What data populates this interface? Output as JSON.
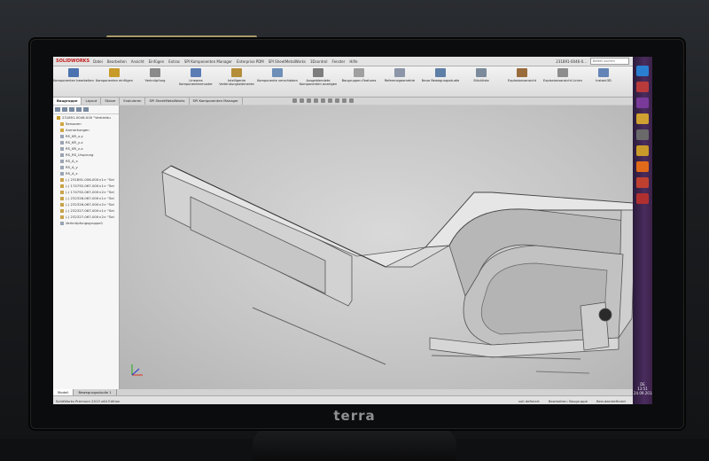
{
  "monitor": {
    "brand": "terra"
  },
  "app": {
    "logo": "SOLIDWORKS",
    "menu": [
      "Datei",
      "Bearbeiten",
      "Ansicht",
      "Einfügen",
      "Extras",
      "SPI Komponenten Manager",
      "Enterprise PDM",
      "SPI SheetMetalWorks",
      "3Dcontrol",
      "Fenster",
      "Hilfe"
    ],
    "document_title": "231891-0046-0...",
    "search_placeholder": "Befehl suchen"
  },
  "ribbon": [
    {
      "label": "Komponenten bearbeiten",
      "color": "#4b73b0"
    },
    {
      "label": "Komponenten einfügen",
      "color": "#c89a2a"
    },
    {
      "label": "Verknüpfung",
      "color": "#8a8a8a"
    },
    {
      "label": "Lineares Komponentenmuster",
      "color": "#5b7db5"
    },
    {
      "label": "Intelligente Verbindungselemente",
      "color": "#b58e3a"
    },
    {
      "label": "Komponente verschieben",
      "color": "#6e8fb8"
    },
    {
      "label": "Ausgeblendete Komponenten anzeigen",
      "color": "#7d7d7d"
    },
    {
      "label": "Baugruppen-Features",
      "color": "#a0a0a0"
    },
    {
      "label": "Referenzgeometrie",
      "color": "#8c96a8"
    },
    {
      "label": "Neue Bewegungsstudie",
      "color": "#5e7fa7"
    },
    {
      "label": "Stückliste",
      "color": "#7b8b9c"
    },
    {
      "label": "Explosionsansicht",
      "color": "#9a6c3c"
    },
    {
      "label": "Explosionsansicht Linien",
      "color": "#8d8d8d"
    },
    {
      "label": "Instant3D",
      "color": "#6384b6"
    }
  ],
  "tabs": [
    "Baugruppe",
    "Layout",
    "Skizze",
    "Evaluieren",
    "SPI SheetMetalWorks",
    "SPI Komponenten Manager"
  ],
  "tree": {
    "items": [
      {
        "label": "231891-0046-000 \"Verkleidu",
        "color": "#c79b2b"
      },
      {
        "label": "Sensoren",
        "color": "#d0a842"
      },
      {
        "label": "Anmerkungen",
        "color": "#d0a842"
      },
      {
        "label": "RS_KR_x-y",
        "color": "#9aa4b3"
      },
      {
        "label": "RS_KR_y-z",
        "color": "#9aa4b3"
      },
      {
        "label": "RS_KR_z-x",
        "color": "#9aa4b3"
      },
      {
        "label": "RS_RS_Ursprung",
        "color": "#9aa4b3"
      },
      {
        "label": "RS_A_x",
        "color": "#9aa4b3"
      },
      {
        "label": "RS_A_y",
        "color": "#9aa4b3"
      },
      {
        "label": "RS_A_z",
        "color": "#9aa4b3"
      },
      {
        "label": "(-) 231891-006-000<1> \"Sei",
        "color": "#c8a24a"
      },
      {
        "label": "(-) 174792-067-000<1> \"Sei",
        "color": "#c8a24a"
      },
      {
        "label": "(-) 174792-067-000<2> \"Sei",
        "color": "#c8a24a"
      },
      {
        "label": "(-) 232326-067-000<1> \"Sei",
        "color": "#c8a24a"
      },
      {
        "label": "(-) 232326-067-000<2> \"Sei",
        "color": "#c8a24a"
      },
      {
        "label": "(-) 232327-067-000<1> \"Sei",
        "color": "#c8a24a"
      },
      {
        "label": "(-) 232327-067-000<2> \"Sei",
        "color": "#c8a24a"
      },
      {
        "label": "Verknüpfungsgruppe1",
        "color": "#9aa4b3"
      }
    ]
  },
  "bottom_tabs": [
    "Modell",
    "Bewegungsstudie 1"
  ],
  "status": {
    "left": "SolidWorks Premium 2013 x64 Edition",
    "center": "voll definiert",
    "mode": "Bearbeiten: Baugruppe",
    "units": "Benutzerdefiniert"
  },
  "taskbar": {
    "time": "13:51",
    "date": "24.09.2014",
    "lang": "DE",
    "icons": [
      {
        "name": "ie-icon",
        "color": "#2a7fd1"
      },
      {
        "name": "solidworks-icon",
        "color": "#b83a3a"
      },
      {
        "name": "onenote-icon",
        "color": "#7a3a9a"
      },
      {
        "name": "explorer-icon",
        "color": "#d0a030"
      },
      {
        "name": "settings-icon",
        "color": "#6a6a6a"
      },
      {
        "name": "folder-icon",
        "color": "#c99a2a"
      },
      {
        "name": "excel-icon",
        "color": "#e06a1a"
      },
      {
        "name": "outlook-icon",
        "color": "#c04030"
      },
      {
        "name": "media-icon",
        "color": "#b03030"
      }
    ]
  }
}
